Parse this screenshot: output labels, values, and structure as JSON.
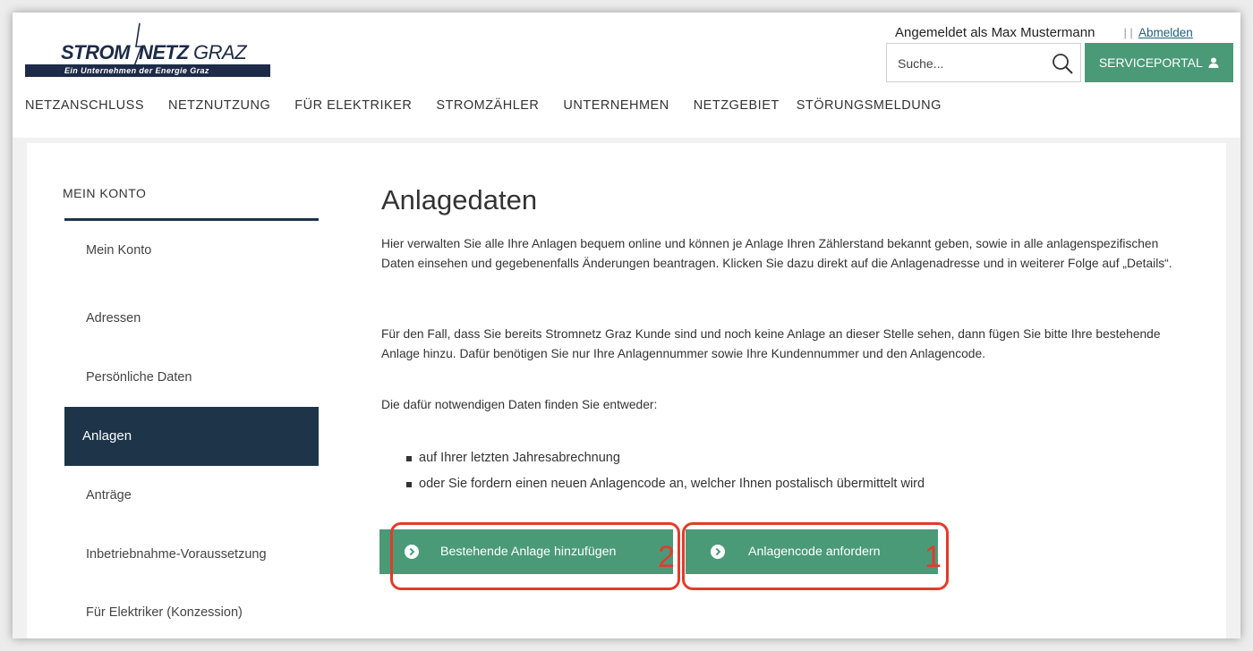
{
  "header": {
    "logo": {
      "main": "STROM",
      "second": "NETZ",
      "third": "GRAZ",
      "tagline": "Ein Unternehmen der Energie Graz"
    },
    "user_status": "Angemeldet als Max Mustermann",
    "separator": "| |",
    "logout_label": "Abmelden",
    "search_placeholder": "Suche...",
    "serviceportal_label": "SERVICEPORTAL",
    "nav": [
      "NETZANSCHLUSS",
      "NETZNUTZUNG",
      "FÜR ELEKTRIKER",
      "STROMZÄHLER",
      "UNTERNEHMEN",
      "NETZGEBIET",
      "STÖRUNGSMELDUNG"
    ]
  },
  "sidebar": {
    "title": "MEIN KONTO",
    "items": [
      {
        "label": "Mein Konto",
        "active": false
      },
      {
        "label": "Adressen",
        "active": false
      },
      {
        "label": "Persönliche Daten",
        "active": false
      },
      {
        "label": "Anlagen",
        "active": true
      },
      {
        "label": "Anträge",
        "active": false
      },
      {
        "label": "Inbetriebnahme-Voraussetzung",
        "active": false
      },
      {
        "label": "Für Elektriker (Konzession)",
        "active": false
      }
    ]
  },
  "main": {
    "title": "Anlagedaten",
    "paragraphs": [
      "Hier verwalten Sie alle Ihre Anlagen bequem online und können je Anlage Ihren Zählerstand bekannt geben, sowie in alle anlagenspezifischen Daten einsehen und gegebenenfalls Änderungen beantragen. Klicken Sie dazu direkt auf die Anlagenadresse und in weiterer Folge auf „Details“.",
      "Für den Fall, dass Sie bereits Stromnetz Graz Kunde sind und noch keine Anlage an dieser Stelle sehen, dann fügen Sie bitte Ihre bestehende Anlage hinzu. Dafür benötigen Sie nur Ihre Anlagennummer sowie Ihre Kundennummer und den Anlagencode.",
      "Die dafür notwendigen Daten finden Sie entweder:"
    ],
    "bullets": [
      "auf Ihrer letzten Jahresabrechnung",
      "oder Sie fordern einen neuen Anlagencode an, welcher Ihnen postalisch übermittelt wird"
    ],
    "buttons": {
      "add_existing": "Bestehende Anlage hinzufügen",
      "request_code": "Anlagencode anfordern"
    },
    "annotations": {
      "add_existing": "2",
      "request_code": "1"
    }
  },
  "colors": {
    "accent_green": "#4a9a78",
    "navy": "#1d3449",
    "annotation_red": "#e33b2a"
  }
}
